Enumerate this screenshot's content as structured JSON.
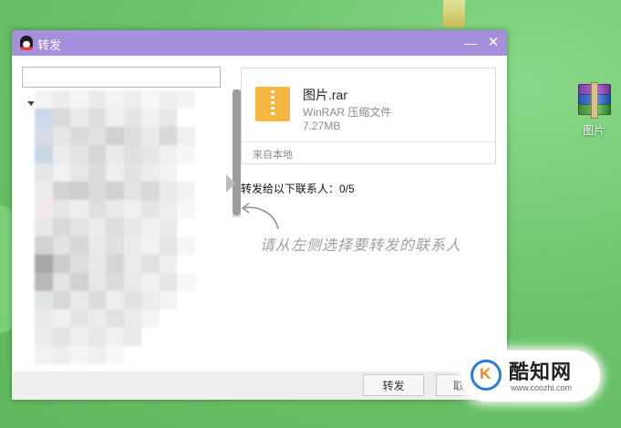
{
  "window": {
    "title": "转发",
    "minimize_glyph": "—",
    "close_glyph": "✕"
  },
  "search": {
    "value": "",
    "placeholder": ""
  },
  "file": {
    "name": "图片.rar",
    "type": "WinRAR 压缩文件",
    "size": "7.27MB",
    "source": "来自本地"
  },
  "recipients": {
    "label": "转发给以下联系人：0/5"
  },
  "hint": {
    "text": "请从左侧选择要转发的联系人"
  },
  "buttons": {
    "forward": "转发",
    "cancel": "取消"
  },
  "desktop": {
    "icon_label": "图片"
  },
  "watermark": {
    "name": "酷知网",
    "url": "www.coozhi.com"
  },
  "colors": {
    "titlebar": "#a58fdc",
    "desktop": "#6cc46a",
    "file_icon": "#f5b740"
  }
}
